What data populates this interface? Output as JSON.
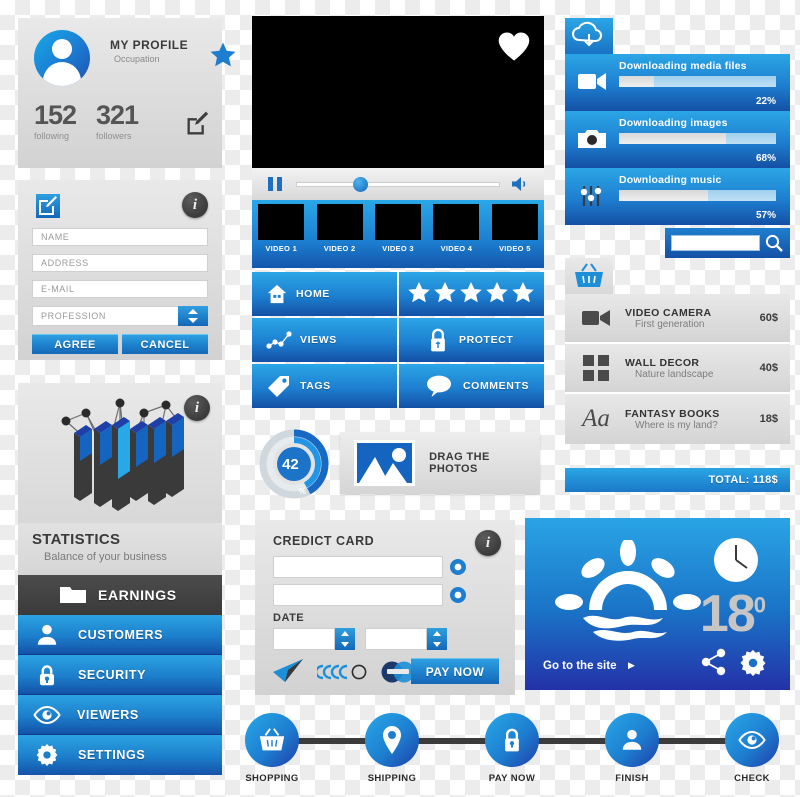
{
  "profile": {
    "title": "MY PROFILE",
    "occupation": "Occupation",
    "star_icon": "star-icon",
    "avatar_icon": "avatar-icon",
    "edit_icon": "edit-pencil-icon",
    "following_count": "152",
    "following_label": "following",
    "followers_count": "321",
    "followers_label": "followers"
  },
  "form": {
    "edit_icon": "edit-pencil-icon",
    "info_icon": "info-icon",
    "fields": [
      {
        "name": "name",
        "placeholder": "NAME",
        "value": ""
      },
      {
        "name": "address",
        "placeholder": "ADDRESS",
        "value": ""
      },
      {
        "name": "email",
        "placeholder": "E-MAIL",
        "value": ""
      },
      {
        "name": "profession",
        "placeholder": "PROFESSION",
        "value": ""
      }
    ],
    "agree_label": "AGREE",
    "cancel_label": "CANCEL"
  },
  "statistics": {
    "info_icon": "info-icon",
    "title": "STATISTICS",
    "subtitle": "Balance of your business",
    "chart_icon": "bar-chart-3d-icon"
  },
  "menu": {
    "items": [
      {
        "label": "EARNINGS",
        "icon": "folder-icon",
        "style": "dark"
      },
      {
        "label": "CUSTOMERS",
        "icon": "user-icon",
        "style": "blue"
      },
      {
        "label": "SECURITY",
        "icon": "lock-icon",
        "style": "blue"
      },
      {
        "label": "VIEWERS",
        "icon": "eye-icon",
        "style": "blue"
      },
      {
        "label": "SETTINGS",
        "icon": "gear-icon",
        "style": "blue"
      }
    ]
  },
  "player": {
    "screen_label": "video-screen",
    "heart_icon": "heart-icon",
    "pause_icon": "pause-icon",
    "volume_icon": "volume-icon",
    "seek_position_pct": 28,
    "thumbnails": [
      {
        "label": "VIDEO 1"
      },
      {
        "label": "VIDEO 2"
      },
      {
        "label": "VIDEO 3"
      },
      {
        "label": "VIDEO 4"
      },
      {
        "label": "VIDEO 5"
      }
    ]
  },
  "navgrid": {
    "cells": [
      {
        "label": "HOME",
        "icon": "home-icon"
      },
      {
        "label": "",
        "icon": "stars-rating-icon",
        "stars": 5
      },
      {
        "label": "VIEWS",
        "icon": "line-chart-icon"
      },
      {
        "label": "PROTECT",
        "icon": "lock-icon"
      },
      {
        "label": "TAGS",
        "icon": "tag-icon"
      },
      {
        "label": "COMMENTS",
        "icon": "comment-bubble-icon"
      }
    ]
  },
  "progress": {
    "value": "42",
    "unit": "%",
    "ring_pct": 42
  },
  "dragbox": {
    "label": "DRAG THE PHOTOS",
    "icon": "image-photo-icon"
  },
  "credit_card": {
    "title": "CREDICT CARD",
    "info_icon": "info-icon",
    "card_fields": [
      {
        "name": "card-number",
        "value": ""
      },
      {
        "name": "card-holder",
        "value": ""
      }
    ],
    "date_label": "DATE",
    "date_fields": [
      {
        "name": "date-month",
        "value": ""
      },
      {
        "name": "date-year",
        "value": ""
      }
    ],
    "pay_label": "PAY NOW",
    "payment_icons": [
      "paper-plane-icon",
      "visa-card-icon",
      "mastercard-icon"
    ]
  },
  "downloads": {
    "cloud_icon": "cloud-download-icon",
    "rows": [
      {
        "title": "Downloading media files",
        "pct": "22%",
        "value": 22,
        "icon": "video-camera-icon"
      },
      {
        "title": "Downloading images",
        "pct": "68%",
        "value": 68,
        "icon": "camera-icon"
      },
      {
        "title": "Downloading music",
        "pct": "57%",
        "value": 57,
        "icon": "equalizer-icon"
      }
    ],
    "search_placeholder": "",
    "search_value": "",
    "search_icon": "search-icon"
  },
  "cart": {
    "basket_icon": "shopping-basket-icon",
    "items": [
      {
        "name": "VIDEO CAMERA",
        "desc": "First generation",
        "price": "60$",
        "icon": "video-camera-icon"
      },
      {
        "name": "WALL DECOR",
        "desc": "Nature landscape",
        "price": "40$",
        "icon": "grid-squares-icon"
      },
      {
        "name": "FANTASY BOOKS",
        "desc": "Where is my land?",
        "price": "18$",
        "icon": "typography-aa-icon"
      }
    ],
    "total_label": "TOTAL: 118$"
  },
  "weather": {
    "sun_icon": "sunset-wave-icon",
    "clock_icon": "clock-icon",
    "temperature": "18",
    "degree": "0",
    "cta_label": "Go to the site",
    "cta_arrow": "play-arrow-icon",
    "share_icon": "share-icon",
    "gear_icon": "gear-icon"
  },
  "steps": {
    "items": [
      {
        "label": "SHOPPING",
        "icon": "shopping-basket-icon"
      },
      {
        "label": "SHIPPING",
        "icon": "map-pin-icon"
      },
      {
        "label": "PAY NOW",
        "icon": "lock-icon"
      },
      {
        "label": "FINISH",
        "icon": "user-icon"
      },
      {
        "label": "CHECK",
        "icon": "eye-icon"
      }
    ]
  },
  "colors": {
    "accent_blue": "#1d7ed0",
    "light_blue": "#2ba6e6",
    "deep_blue": "#1450a5",
    "dark_grey": "#3b3b3b",
    "panel_grey": "#dcdcdc"
  }
}
